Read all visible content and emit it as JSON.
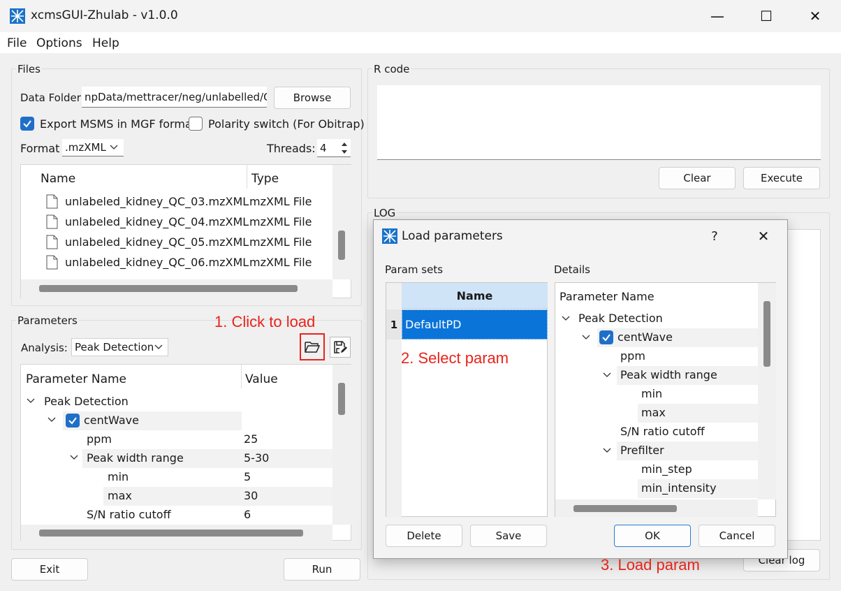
{
  "window": {
    "title": "xcmsGUI-Zhulab - v1.0.0",
    "controls": [
      "—",
      "☐",
      "✕"
    ]
  },
  "menu": [
    "File",
    "Options",
    "Help"
  ],
  "files": {
    "group_title": "Files",
    "data_folder_label": "Data Folder",
    "data_folder_value": "npData/mettracer/neg/unlabelled/QC",
    "browse_label": "Browse",
    "export_msms_label": "Export MSMS in MGF format",
    "export_msms_checked": true,
    "polarity_label": "Polarity switch (For Obitrap)",
    "polarity_checked": false,
    "format_label": "Format",
    "format_value": ".mzXML",
    "threads_label": "Threads:",
    "threads_value": "4",
    "columns": [
      "Name",
      "Type"
    ],
    "rows": [
      {
        "name": "unlabeled_kidney_QC_03.mzXML",
        "type": "mzXML File"
      },
      {
        "name": "unlabeled_kidney_QC_04.mzXML",
        "type": "mzXML File"
      },
      {
        "name": "unlabeled_kidney_QC_05.mzXML",
        "type": "mzXML File"
      },
      {
        "name": "unlabeled_kidney_QC_06.mzXML",
        "type": "mzXML File"
      }
    ]
  },
  "parameters": {
    "group_title": "Parameters",
    "analysis_label": "Analysis:",
    "analysis_value": "Peak Detection",
    "columns": [
      "Parameter Name",
      "Value"
    ],
    "rows": [
      {
        "name": "Peak Detection",
        "value": ""
      },
      {
        "name": "centWave",
        "value": ""
      },
      {
        "name": "ppm",
        "value": "25"
      },
      {
        "name": "Peak width range",
        "value": "5-30"
      },
      {
        "name": "min",
        "value": "5"
      },
      {
        "name": "max",
        "value": "30"
      },
      {
        "name": "S/N ratio cutoff",
        "value": "6"
      }
    ]
  },
  "rcode": {
    "group_title": "R code",
    "clear_label": "Clear",
    "execute_label": "Execute"
  },
  "log": {
    "group_title": "LOG",
    "clear_log_label": "Clear log"
  },
  "bottom": {
    "exit_label": "Exit",
    "run_label": "Run"
  },
  "dialog": {
    "title": "Load parameters",
    "help": "?",
    "close": "✕",
    "param_sets_label": "Param sets",
    "details_label": "Details",
    "sets_header": "Name",
    "sets": [
      {
        "index": "1",
        "name": "DefaultPD"
      }
    ],
    "details_header": "Parameter Name",
    "details": [
      "Peak Detection",
      "centWave",
      "ppm",
      "Peak width range",
      "min",
      "max",
      "S/N ratio cutoff",
      "Prefilter",
      "min_step",
      "min_intensity"
    ],
    "delete_label": "Delete",
    "save_label": "Save",
    "ok_label": "OK",
    "cancel_label": "Cancel"
  },
  "annotations": {
    "step1": "1. Click to load",
    "step2": "2. Select param",
    "step3": "3. Load param"
  },
  "colors": {
    "accent": "#1f6fc9",
    "selection": "#0a74d9",
    "annotation": "#e8231b"
  }
}
